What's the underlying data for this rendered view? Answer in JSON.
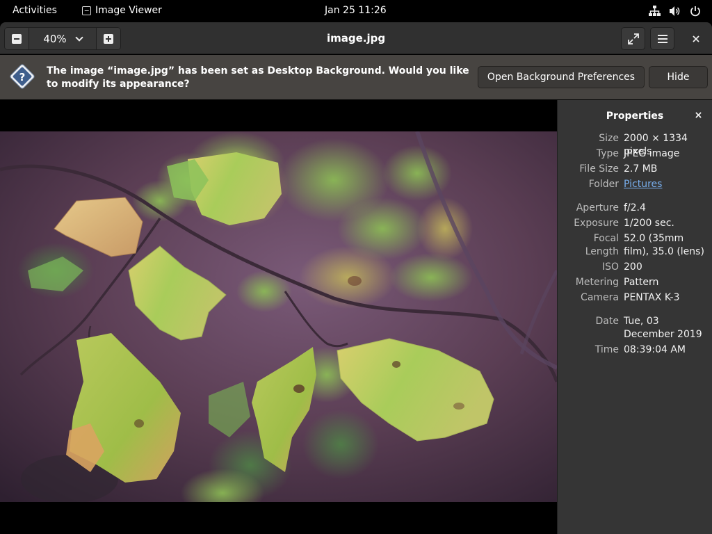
{
  "topbar": {
    "activities": "Activities",
    "app_name": "Image Viewer",
    "clock": "Jan 25  11:26",
    "tray_icons": [
      "network-icon",
      "volume-icon",
      "power-icon"
    ]
  },
  "header": {
    "zoom_level": "40%",
    "title": "image.jpg"
  },
  "infobar": {
    "message": "The image “image.jpg” has been set as Desktop Background. Would you like to modify its appearance?",
    "open_button": "Open Background Preferences",
    "hide_button": "Hide"
  },
  "sidebar": {
    "title": "Properties",
    "props": [
      {
        "key": "Size",
        "value": "2000 × 1334 pixels"
      },
      {
        "key": "Type",
        "value": "JPEG image"
      },
      {
        "key": "File Size",
        "value": "2.7 MB"
      },
      {
        "key": "Folder",
        "value": "Pictures"
      },
      {
        "key": "Aperture",
        "value": "f/2.4"
      },
      {
        "key": "Exposure",
        "value": "1/200 sec."
      },
      {
        "key": "Focal Length",
        "value": "52.0 (35mm film), 35.0 (lens)"
      },
      {
        "key": "ISO",
        "value": "200"
      },
      {
        "key": "Metering",
        "value": "Pattern"
      },
      {
        "key": "Camera",
        "value": "PENTAX K-3"
      },
      {
        "key": "Date",
        "value": "Tue, 03 December 2019"
      },
      {
        "key": "Time",
        "value": "08:39:04 AM"
      }
    ]
  },
  "colors": {
    "link": "#78aeed",
    "infobar_bg": "#474441",
    "sidebar_bg": "#353535"
  }
}
